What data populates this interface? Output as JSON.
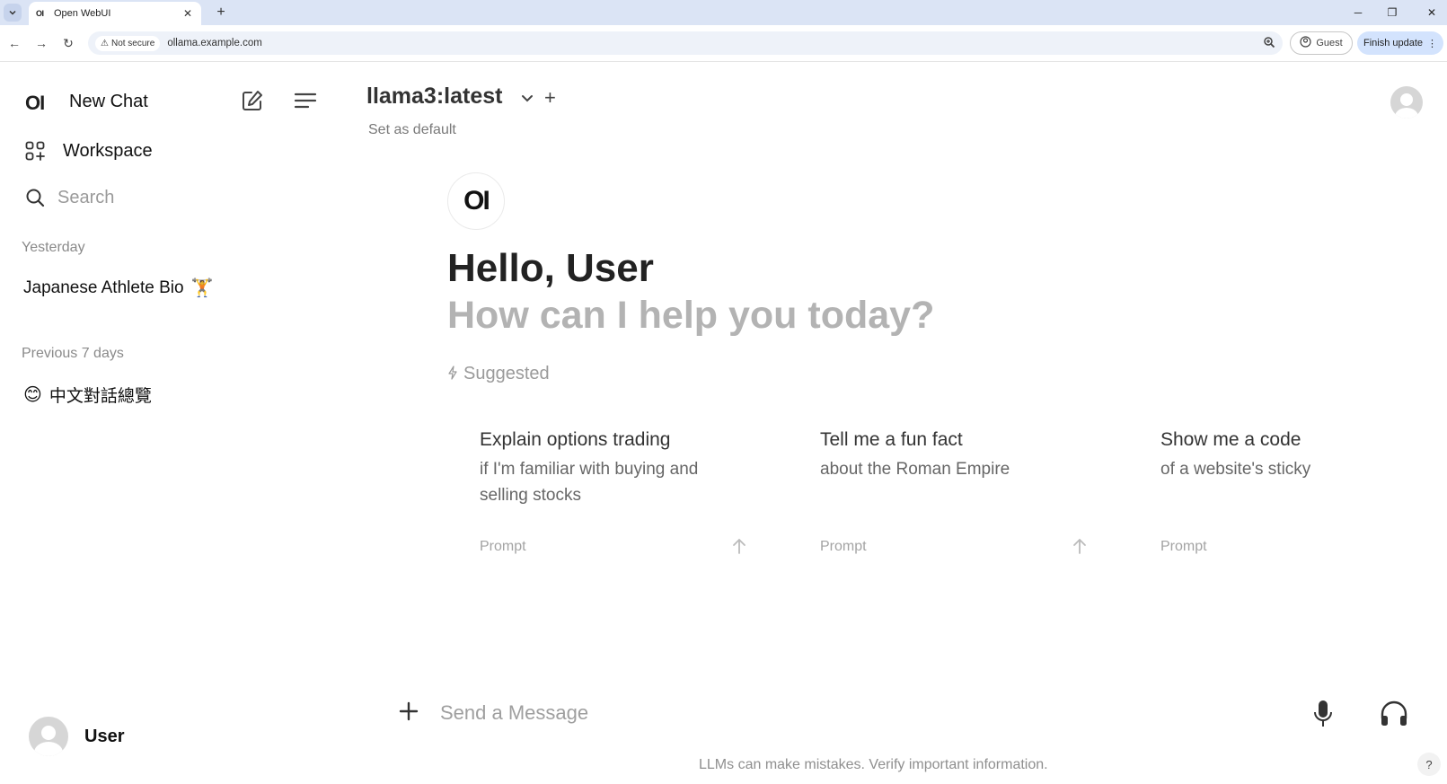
{
  "browser": {
    "tab_title": "Open WebUI",
    "tab_favicon": "OI",
    "security_label": "Not secure",
    "url": "ollama.example.com",
    "guest_label": "Guest",
    "update_label": "Finish update"
  },
  "sidebar": {
    "brand": "OI",
    "new_chat_label": "New Chat",
    "workspace_label": "Workspace",
    "search_placeholder": "Search",
    "groups": [
      {
        "label": "Yesterday",
        "items": [
          {
            "title": "Japanese Athlete Bio",
            "emoji": "🏋️"
          }
        ]
      },
      {
        "label": "Previous 7 days",
        "items": [
          {
            "title": "中文對話總覽",
            "emoji": "😊"
          }
        ]
      }
    ],
    "user_name": "User"
  },
  "header": {
    "model_name": "llama3:latest",
    "set_default": "Set as default"
  },
  "main": {
    "logo": "OI",
    "greeting": "Hello, User",
    "subgreeting": "How can I help you today?",
    "suggested_label": "Suggested",
    "suggestions": [
      {
        "title": "Explain options trading",
        "subtitle": "if I'm familiar with buying and selling stocks",
        "prompt_label": "Prompt"
      },
      {
        "title": "Tell me a fun fact",
        "subtitle": "about the Roman Empire",
        "prompt_label": "Prompt"
      },
      {
        "title": "Show me a code",
        "subtitle": "of a website's sticky",
        "prompt_label": "Prompt"
      }
    ]
  },
  "composer": {
    "placeholder": "Send a Message",
    "disclaimer": "LLMs can make mistakes. Verify important information.",
    "help_label": "?"
  },
  "icons": {
    "edit": "edit-icon",
    "menu": "menu-icon",
    "workspace": "workspace-icon",
    "search": "search-icon",
    "mic": "microphone-icon",
    "headphones": "headphones-icon"
  }
}
